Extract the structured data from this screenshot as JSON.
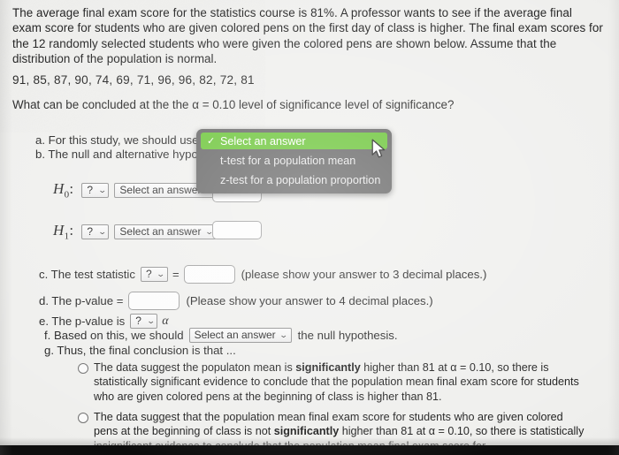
{
  "problem": {
    "paragraph": "The average final exam score for the statistics course is 81%. A professor wants to see if the average final exam score for students who are given colored pens on the first day of class is higher. The final exam scores for the 12 randomly selected students who were given the colored pens are shown below. Assume that the distribution of the population is normal.",
    "data_values": "91, 85, 87, 90, 74, 69, 71, 96, 96, 82, 72, 81",
    "question": "What can be concluded at the the α = 0.10 level of significance level of significance?"
  },
  "items": {
    "a": "a. For this study, we should use",
    "b": "b. The null and alternative hypotheses would be:",
    "c_lead": "c. The test statistic",
    "c_equals": "=",
    "c_tail": "(please show your answer to 3 decimal places.)",
    "d_lead": "d. The p-value =",
    "d_tail": "(Please show your answer to 4 decimal places.)",
    "e_lead": "e. The p-value is",
    "e_alpha": "α",
    "f_lead": "f. Based on this, we should",
    "f_tail": "the null hypothesis.",
    "g": "g. Thus, the final conclusion is that ..."
  },
  "hypotheses": {
    "h0_label": "H",
    "h0_sub": "0",
    "h1_label": "H",
    "h1_sub": "1",
    "colon": ":"
  },
  "controls": {
    "question_mark": "?",
    "caret": "⌄",
    "select_an_answer": "Select an answer",
    "h0_symbol_value": "?",
    "h0_param_value": "Select an answer",
    "h0_number_value": "",
    "h1_symbol_value": "?",
    "h1_param_value": "Select an answer",
    "h1_number_value": "",
    "test_statistic_symbol_value": "?",
    "test_statistic_value": "",
    "p_value_value": "",
    "p_value_compare_value": "?",
    "decision_value": "Select an answer"
  },
  "dropdown": {
    "open": true,
    "checkmark": "✓",
    "options": [
      "Select an answer",
      "t-test for a population mean",
      "z-test for a population proportion"
    ],
    "selected_index": 0,
    "highlight_color": "#63c22d",
    "panel_color": "#5e5e5e"
  },
  "conclusion_options": [
    {
      "part1": "The data suggest the populaton mean is ",
      "bold1": "significantly",
      "part2": " higher than 81 at α = 0.10, so there is statistically significant evidence to conclude that the population mean final exam score for students who are given colored pens at the beginning of class is higher than 81.",
      "selected": false
    },
    {
      "part1": "The data suggest that the population mean final exam score for students who are given colored pens at the beginning of class is not ",
      "bold1": "significantly",
      "part2": " higher than 81 at α = 0.10, so there is statistically insignificant evidence to conclude that the population mean final exam score for",
      "selected": false
    }
  ]
}
